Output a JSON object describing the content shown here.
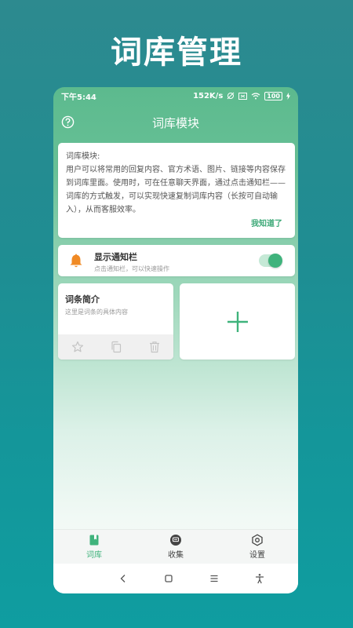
{
  "headline": "词库管理",
  "status": {
    "time": "下午5:44",
    "speed": "152K/s",
    "battery": "100"
  },
  "appbar": {
    "title": "词库模块"
  },
  "intro": {
    "heading": "词库模块:",
    "body": "用户可以将常用的回复内容、官方术语、图片、链接等内容保存到词库里面。使用时，可在任意聊天界面，通过点击通知栏——词库的方式触发，可以实现快速复制词库内容（长按可自动输入），从而客服效率。",
    "confirm_label": "我知道了"
  },
  "notify": {
    "title": "显示通知栏",
    "subtitle": "点击通知栏，可以快速操作",
    "enabled": true
  },
  "entry": {
    "title": "词条简介",
    "subtitle": "这里是词条的具体内容"
  },
  "bottom_nav": [
    {
      "label": "词库",
      "icon": "bookmark-book-icon",
      "active": true
    },
    {
      "label": "收集",
      "icon": "chat-bubble-icon",
      "active": false
    },
    {
      "label": "设置",
      "icon": "hexagon-gear-icon",
      "active": false
    }
  ],
  "colors": {
    "accent": "#3fb37c",
    "header": "#5cba8e",
    "bell": "#f08a24"
  }
}
